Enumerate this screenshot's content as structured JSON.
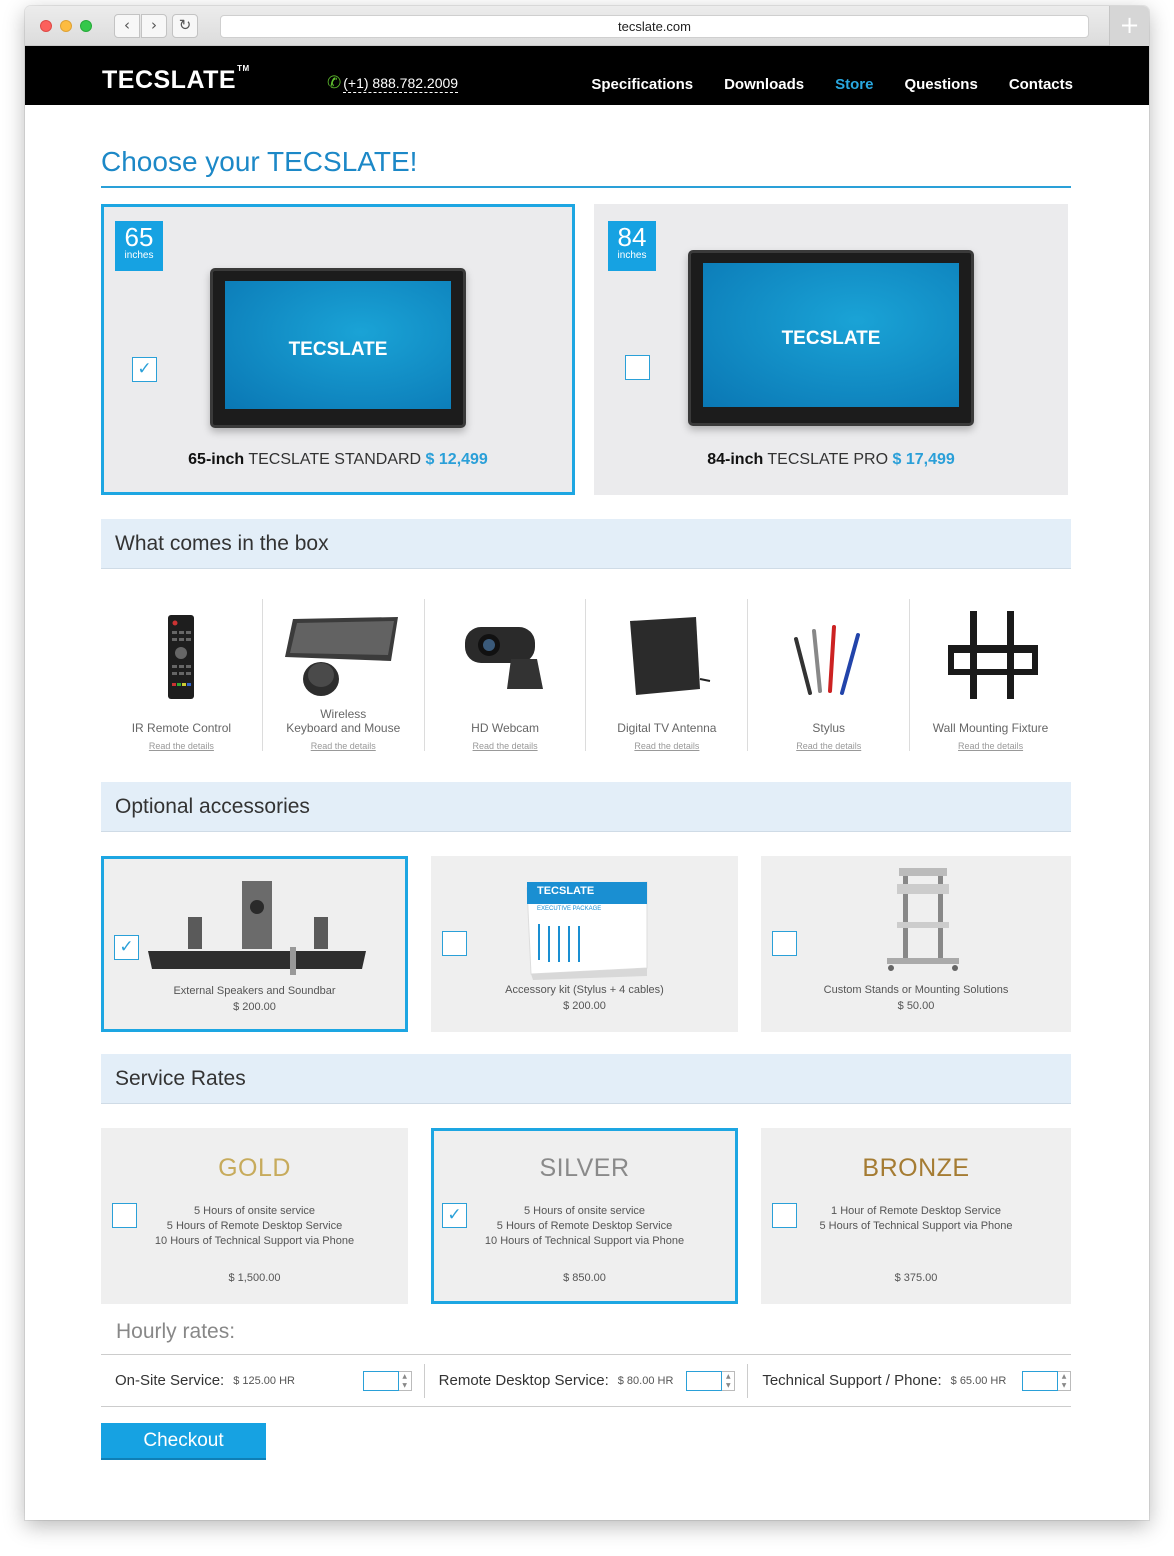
{
  "browser": {
    "url": "tecslate.com"
  },
  "header": {
    "logo": "TECSLATE",
    "logo_tm": "TM",
    "phone": "(+1) 888.782.2009",
    "nav": [
      {
        "label": "Specifications"
      },
      {
        "label": "Downloads"
      },
      {
        "label": "Store"
      },
      {
        "label": "Questions"
      },
      {
        "label": "Contacts"
      }
    ]
  },
  "title": "Choose your TECSLATE!",
  "products": [
    {
      "size": "65",
      "unit": "inches",
      "screen_brand": "TECSLATE",
      "bold": "65-inch",
      "name": "TECSLATE STANDARD",
      "price": "$ 12,499",
      "selected": true
    },
    {
      "size": "84",
      "unit": "inches",
      "screen_brand": "TECSLATE",
      "bold": "84-inch",
      "name": "TECSLATE PRO",
      "price": "$ 17,499",
      "selected": false
    }
  ],
  "box_section": {
    "title": "What comes in the box",
    "items": [
      {
        "name": "IR Remote Control",
        "link": "Read the details"
      },
      {
        "name_line1": "Wireless",
        "name": "Keyboard and Mouse",
        "link": "Read the details"
      },
      {
        "name": "HD Webcam",
        "link": "Read the details"
      },
      {
        "name": "Digital TV Antenna",
        "link": "Read the details"
      },
      {
        "name": "Stylus",
        "link": "Read the details"
      },
      {
        "name": "Wall Mounting Fixture",
        "link": "Read the details"
      }
    ]
  },
  "accessories": {
    "title": "Optional accessories",
    "kit_box_title": "TECSLATE",
    "kit_box_subtitle": "EXECUTIVE PACKAGE",
    "items": [
      {
        "name": "External Speakers and Soundbar",
        "price": "$ 200.00",
        "selected": true
      },
      {
        "name": "Accessory kit (Stylus + 4 cables)",
        "price": "$ 200.00",
        "selected": false
      },
      {
        "name": "Custom Stands or Mounting Solutions",
        "price": "$ 50.00",
        "selected": false
      }
    ]
  },
  "service": {
    "title": "Service Rates",
    "plans": [
      {
        "name": "GOLD",
        "color": "#c7ab5c",
        "features": [
          "5 Hours of onsite service",
          "5 Hours of Remote Desktop Service",
          "10 Hours of Technical Support via Phone"
        ],
        "price": "$ 1,500.00",
        "selected": false
      },
      {
        "name": "SILVER",
        "color": "#8a8a8a",
        "features": [
          "5 Hours of onsite service",
          "5 Hours of Remote Desktop Service",
          "10 Hours of Technical Support via Phone"
        ],
        "price": "$ 850.00",
        "selected": true
      },
      {
        "name": "BRONZE",
        "color": "#a57c33",
        "features": [
          "1 Hour of Remote Desktop Service",
          "5 Hours of Technical Support via Phone"
        ],
        "price": "$ 375.00",
        "selected": false
      }
    ]
  },
  "hourly": {
    "title": "Hourly rates:",
    "rates": [
      {
        "label": "On-Site Service:",
        "value": "$ 125.00 HR"
      },
      {
        "label": "Remote Desktop Service:",
        "value": "$ 80.00 HR"
      },
      {
        "label": "Technical Support / Phone:",
        "value": "$ 65.00 HR"
      }
    ]
  },
  "checkout_label": "Checkout",
  "colors": {
    "accent": "#16a2e2",
    "header_bg": "#000000",
    "section_bg": "#e3eef8"
  }
}
